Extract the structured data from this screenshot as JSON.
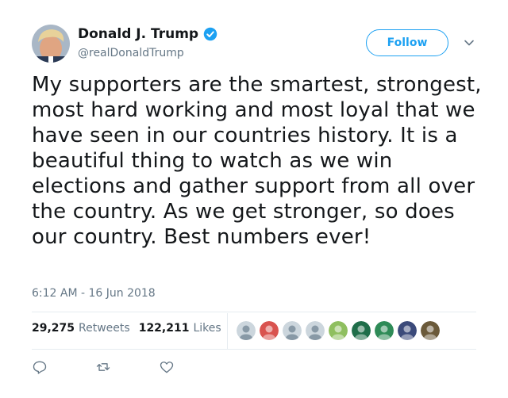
{
  "user": {
    "name": "Donald J. Trump",
    "handle": "@realDonaldTrump",
    "verified": true
  },
  "follow_label": "Follow",
  "tweet": {
    "text": "My supporters are the smartest, strongest, most hard working and most loyal that we have seen in our countries history. It is a beautiful thing to watch as we win elections and gather support from all over the country. As we get stronger, so does our country. Best numbers ever!",
    "timestamp": "6:12 AM - 16 Jun 2018"
  },
  "stats": {
    "retweets_count": "29,275",
    "retweets_label": "Retweets",
    "likes_count": "122,211",
    "likes_label": "Likes"
  },
  "likers": [
    {
      "icon": "default-avatar-icon",
      "color": "#ccd6dd"
    },
    {
      "icon": "avatar-icon",
      "color": "#d9534f"
    },
    {
      "icon": "default-avatar-icon",
      "color": "#ccd6dd"
    },
    {
      "icon": "default-avatar-icon",
      "color": "#ccd6dd"
    },
    {
      "icon": "avatar-icon",
      "color": "#8fbf5f"
    },
    {
      "icon": "avatar-icon",
      "color": "#1f6e4a"
    },
    {
      "icon": "avatar-icon",
      "color": "#2e8b57"
    },
    {
      "icon": "avatar-icon",
      "color": "#3b4a7a"
    },
    {
      "icon": "avatar-icon",
      "color": "#6b5a3a"
    }
  ],
  "actions": [
    "reply-icon",
    "retweet-icon",
    "like-icon"
  ],
  "colors": {
    "accent": "#1da1f2",
    "secondary_text": "#657786",
    "divider": "#e6ecf0"
  }
}
